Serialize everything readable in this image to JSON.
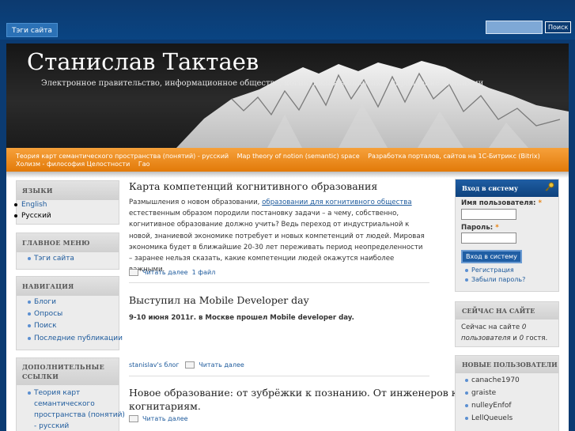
{
  "topbar": {
    "tag_link": "Тэги сайта",
    "search_button": "Поиск",
    "search_value": ""
  },
  "header": {
    "title": "Станислав Тактаев",
    "slogan": "Электронное правительство, информационное общество, когнитивная экономика, управление знаниями"
  },
  "primary_nav": [
    "Теория карт семантического пространства (понятий) - русский",
    "Map theory of notion (semantic) space",
    "Разработка порталов, сайтов на 1С-Битрикс (Bitrix)",
    "Холизм - философия Целостности",
    "Гао"
  ],
  "left": {
    "languages": {
      "title": "ЯЗЫКИ",
      "items": [
        "English",
        "Русский"
      ]
    },
    "main_menu": {
      "title": "ГЛАВНОЕ МЕНЮ",
      "items": [
        "Тэги сайта"
      ]
    },
    "navigation": {
      "title": "НАВИГАЦИЯ",
      "items": [
        "Блоги",
        "Опросы",
        "Поиск",
        "Последние публикации"
      ]
    },
    "extra_links": {
      "title_line1": "ДОПОЛНИТЕЛЬНЫЕ",
      "title_line2": "ССЫЛКИ",
      "item_lines": [
        "Теория карт",
        "семантического",
        "пространства (понятий)",
        "- русский"
      ]
    }
  },
  "posts": [
    {
      "title": "Карта компетенций когнитивного образования",
      "body_prefix": "Размышления о новом образовании, ",
      "body_link": "образовании для когнитивного общества",
      "body_suffix": " естественным образом породили постановку задачи – а чему, собственно, когнитивное образование должно учить? Ведь переход от индустриальной  к новой, знаниевой экономике потребует и новых компетенций от людей. Мировая экономика будет  в ближайшие 20-30 лет переживать период неопределенности – заранее нельзя сказать, какие компетенции  людей окажутся наиболее важными.",
      "read_more": "Читать далее",
      "files": "1 файл"
    },
    {
      "title": "Выступил на Mobile Developer day",
      "body": "9-10 июня 2011г. в Москве прошел Mobile developer day.",
      "blog": "stanislav's блог",
      "read_more": "Читать далее"
    },
    {
      "title_line1": "Новое образование: от зубрёжки к познанию. От инженеров к",
      "title_line2": "когнитариям.",
      "read_more": "Читать далее"
    }
  ],
  "right": {
    "login": {
      "title": "Вход в систему",
      "username_label": "Имя пользователя:",
      "password_label": "Пароль:",
      "required_mark": "*",
      "submit": "Вход в систему",
      "register": "Регистрация",
      "forgot": "Забыли пароль?"
    },
    "online": {
      "title": "СЕЙЧАС НА САЙТЕ",
      "line1_prefix": "Сейчас на сайте ",
      "users_count": "0",
      "line2_a": "пользователя",
      "line2_b": " и ",
      "guests_count": "0",
      "line2_c": " гостя."
    },
    "new_users": {
      "title": "НОВЫЕ ПОЛЬЗОВАТЕЛИ",
      "items": [
        "canache1970",
        "graiste",
        "nulleyEnfof",
        "LellQueuels"
      ]
    }
  },
  "colors": {
    "background": "#0b3b72",
    "accent_orange": "#e8820f",
    "link": "#1d5a9c"
  }
}
